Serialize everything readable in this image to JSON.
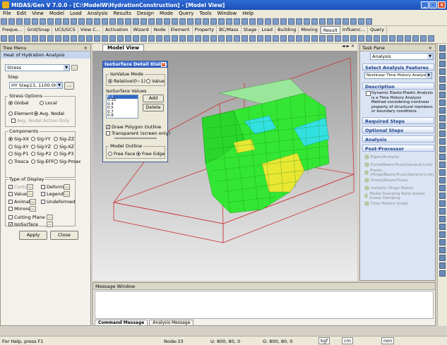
{
  "window": {
    "title": "MIDAS/Gen V 7.0.0 - [C:\\ModelW\\HydrationConstruction] - [Model View]"
  },
  "menu": [
    "File",
    "Edit",
    "View",
    "Model",
    "Load",
    "Analysis",
    "Results",
    "Design",
    "Mode",
    "Query",
    "Tools",
    "Window",
    "Help"
  ],
  "command_tabs": [
    "Freque...",
    "Grid/Snap",
    "UCS/GCS",
    "View C...",
    "Activation",
    "Wizard",
    "Node",
    "Element",
    "Property",
    "BC/Mass",
    "Stage",
    "Load",
    "Building",
    "Moving",
    "Result",
    "Influenc...",
    "Query"
  ],
  "active_command_tab": "Result",
  "tree_menu": {
    "title": "Tree Menu",
    "tab": "Heat of Hydration Analysis",
    "result_type": "Stress",
    "step_label": "Step",
    "step_value": "HY Step13, 1100.0Hr",
    "stress_options": {
      "title": "Stress Options",
      "global": "Global",
      "local": "Local",
      "element": "Element",
      "avg_nodal": "Avg. Nodal",
      "avg_nodal_active": "Avg. Nodal Active Only"
    },
    "components": {
      "title": "Components",
      "items": [
        "Sig-XX",
        "Sig-YY",
        "Sig-ZZ",
        "Sig-XY",
        "Sig-YZ",
        "Sig-XZ",
        "Sig-P1",
        "Sig-P2",
        "Sig-P3",
        "Tresca",
        "Sig-EFF",
        "Sig-Pmax"
      ]
    },
    "type_of_display": {
      "title": "Type of Display",
      "contour": "Contour",
      "deform": "Deform",
      "values": "Values",
      "legend": "Legend",
      "animate": "Animate",
      "undeformed": "Undeformed",
      "mirrored": "Mirrored",
      "cutting_plane": "Cutting Plane",
      "isosurface": "IsoSurface"
    },
    "apply": "Apply",
    "close": "Close"
  },
  "model_view_tab": "Model View",
  "dialog": {
    "title": "IsoSurface Detail Dialog",
    "mode_title": "IsoValue Mode",
    "mode_relative": "Relative(0~1)",
    "mode_value": "Value",
    "values_title": "IsoSurface Values",
    "values": [
      "0.1",
      "0.15",
      "0.4",
      "0.5",
      "0.7",
      "0.8"
    ],
    "add": "Add",
    "delete": "Delete",
    "draw_outline": "Draw Polygon Outline",
    "transparent": "Transparent (screen only)",
    "outline_title": "Model Outline",
    "free_face": "Free Face",
    "free_edge": "Free Edge"
  },
  "task_pane": {
    "title": "Task Pane",
    "mode": "Analysis",
    "select_features": "Select Analysis Features",
    "feature_value": "Nonlinear Time History Analysis",
    "description_title": "Description",
    "description": "Dynamic Elasto-Plastic Analysis is a Time History Analysis Method considering nonlinear property of structural members or boundary conditions.",
    "required_steps": "Required Steps",
    "optional_steps": "Optional Steps",
    "analysis": "Analysis",
    "post_processor": "Post-Processor",
    "post_items": [
      "Eigen/Analysis",
      "Force(Beam/Truss/General Link)",
      "Plastic (Hinge/Beam/Truss/General Link)",
      "Stress(Beam/Truss)",
      "Inelastic Hinge Status",
      "Modal Damping Ratio-based Group Damping",
      "Time History Graph"
    ]
  },
  "message_window": {
    "title": "Message Window",
    "tabs": [
      "Command Message",
      "Analysis Message"
    ]
  },
  "status_bar": {
    "help": "For Help, press F1",
    "node": "Node-33",
    "u": "U: 800, 80, 0",
    "g": "G: 800, 80, 0",
    "force_unit": "kgf",
    "length_unit": "cm",
    "none": "non"
  },
  "colors": {
    "titlebar": "#1b4fb5",
    "mesh_green": "#33e633",
    "mesh_cyan": "#33e0e0",
    "mesh_yellow": "#e8e833",
    "outline_red": "#cc3333"
  }
}
